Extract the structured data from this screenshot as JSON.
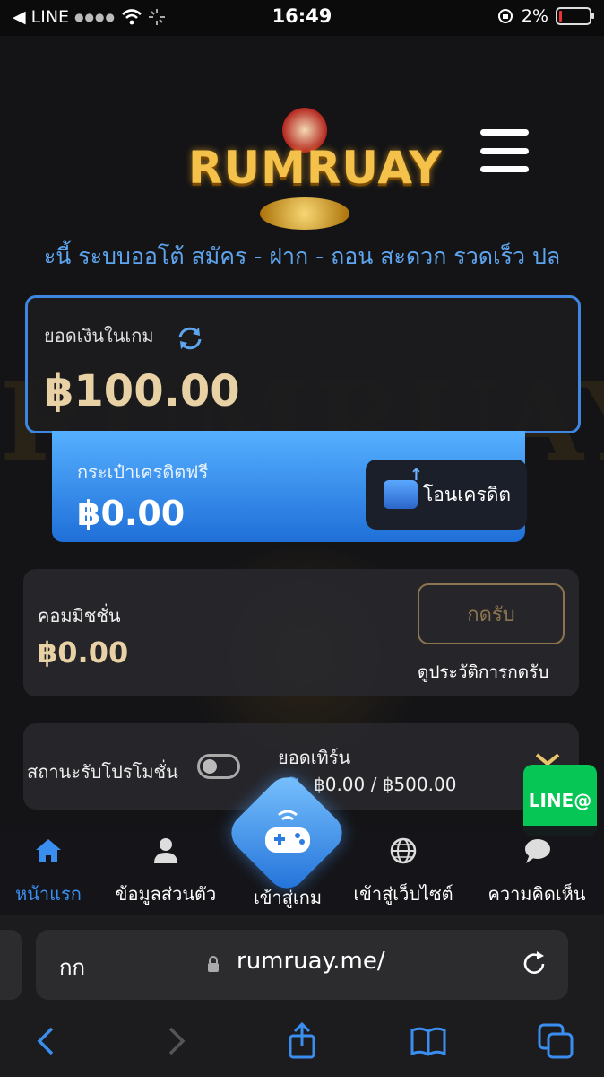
{
  "status_bar": {
    "carrier": "◀ LINE",
    "time": "16:49",
    "battery": "2%",
    "battery_level": 0.02
  },
  "header": {
    "logo_text": "RUMRUAY",
    "menu_icon": "hamburger-icon"
  },
  "marquee": {
    "text": "ะนี้ ระบบออโต้ สมัคร - ฝาก - ถอน สะดวก รวดเร็ว ปล"
  },
  "balance": {
    "label": "ยอดเงินในเกม",
    "value": "฿100.00",
    "refresh_icon": "refresh-icon"
  },
  "free_credit": {
    "label": "กระเป๋าเครดิตฟรี",
    "value": "฿0.00",
    "transfer_label": "โอนเครดิต"
  },
  "commission": {
    "label": "คอมมิชชั่น",
    "value": "฿0.00",
    "claim_label": "กดรับ",
    "history_link": "ดูประวัติการกดรับ"
  },
  "promotion": {
    "label": "สถานะรับโปรโมชั่น",
    "enabled": false,
    "turnover_label": "ยอดเทิร์น",
    "turnover_value": "฿0.00 / ฿500.00"
  },
  "line_badge": {
    "label": "LINE@"
  },
  "bottom_nav": {
    "items": [
      {
        "label": "หน้าแรก",
        "icon": "home-icon"
      },
      {
        "label": "ข้อมูลส่วนตัว",
        "icon": "user-icon"
      },
      {
        "label": "เข้าสู่เกม",
        "icon": "gamepad-icon"
      },
      {
        "label": "เข้าสู่เว็บไซต์",
        "icon": "globe-icon"
      },
      {
        "label": "ความคิดเห็น",
        "icon": "chat-icon"
      }
    ],
    "active_index": 0
  },
  "browser": {
    "aa_label": "กก",
    "url": "rumruay.me/"
  },
  "colors": {
    "accent_blue": "#3a8ef0",
    "gold": "#e8d2a5",
    "line_green": "#06c755"
  }
}
